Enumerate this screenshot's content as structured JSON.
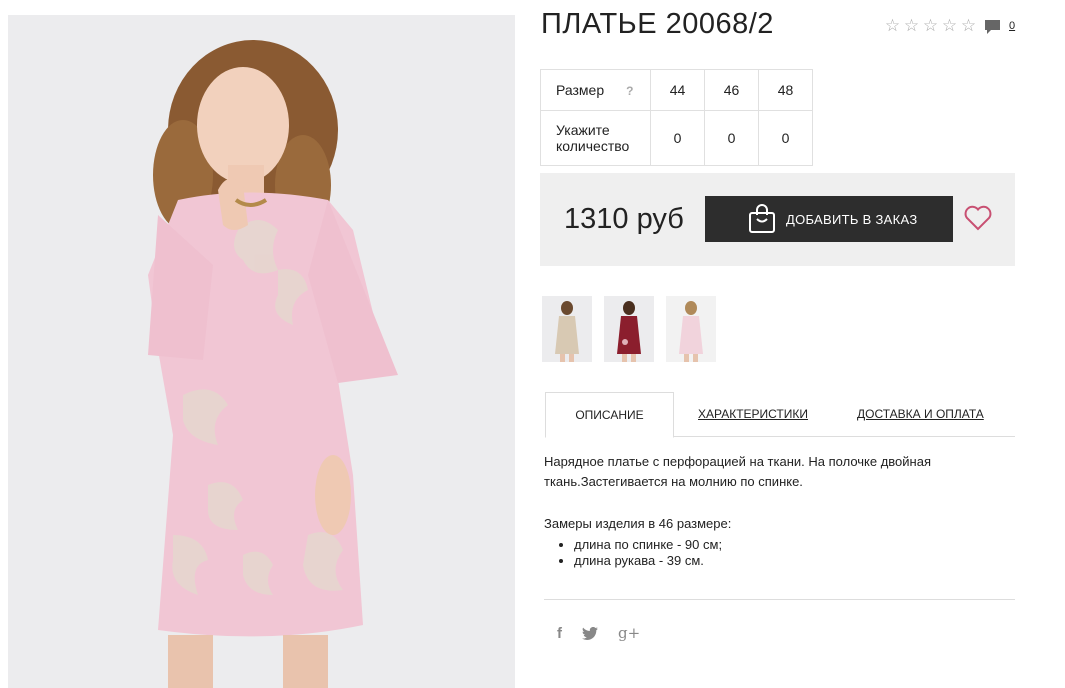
{
  "product": {
    "title": "ПЛАТЬЕ 20068/2",
    "rating": {
      "stars_filled": 0,
      "stars_total": 5
    },
    "comments_count": "0",
    "accent_color": "#c85072"
  },
  "size_table": {
    "size_label": "Размер",
    "size_help": "?",
    "sizes": [
      "44",
      "46",
      "48"
    ],
    "quantity_label": "Укажите количество",
    "quantities": [
      "0",
      "0",
      "0"
    ]
  },
  "purchase": {
    "price": "1310 руб",
    "add_button_label": "ДОБАВИТЬ В ЗАКАЗ"
  },
  "thumbnails": [
    {
      "color": "#d8c9b3",
      "icon": "beige-dress-thumbnail"
    },
    {
      "color": "#8b1e2d",
      "icon": "burgundy-dress-thumbnail"
    },
    {
      "color": "#f1d3dc",
      "icon": "pink-dress-thumbnail"
    }
  ],
  "tabs": [
    {
      "label": "ОПИСАНИЕ",
      "active": true
    },
    {
      "label": "ХАРАКТЕРИСТИКИ",
      "active": false
    },
    {
      "label": "ДОСТАВКА И ОПЛАТА",
      "active": false
    }
  ],
  "description": {
    "text": "Нарядное платье с перфорацией на ткани. На полочке двойная ткань.Застегивается на молнию по спинке.",
    "measurements_title": "Замеры изделия в 46 размере:",
    "measurements": [
      "длина по спинке - 90 см;",
      "длина рукава - 39 см."
    ]
  },
  "social": {
    "facebook": "f",
    "twitter": "🐦",
    "google_plus": "g+"
  }
}
